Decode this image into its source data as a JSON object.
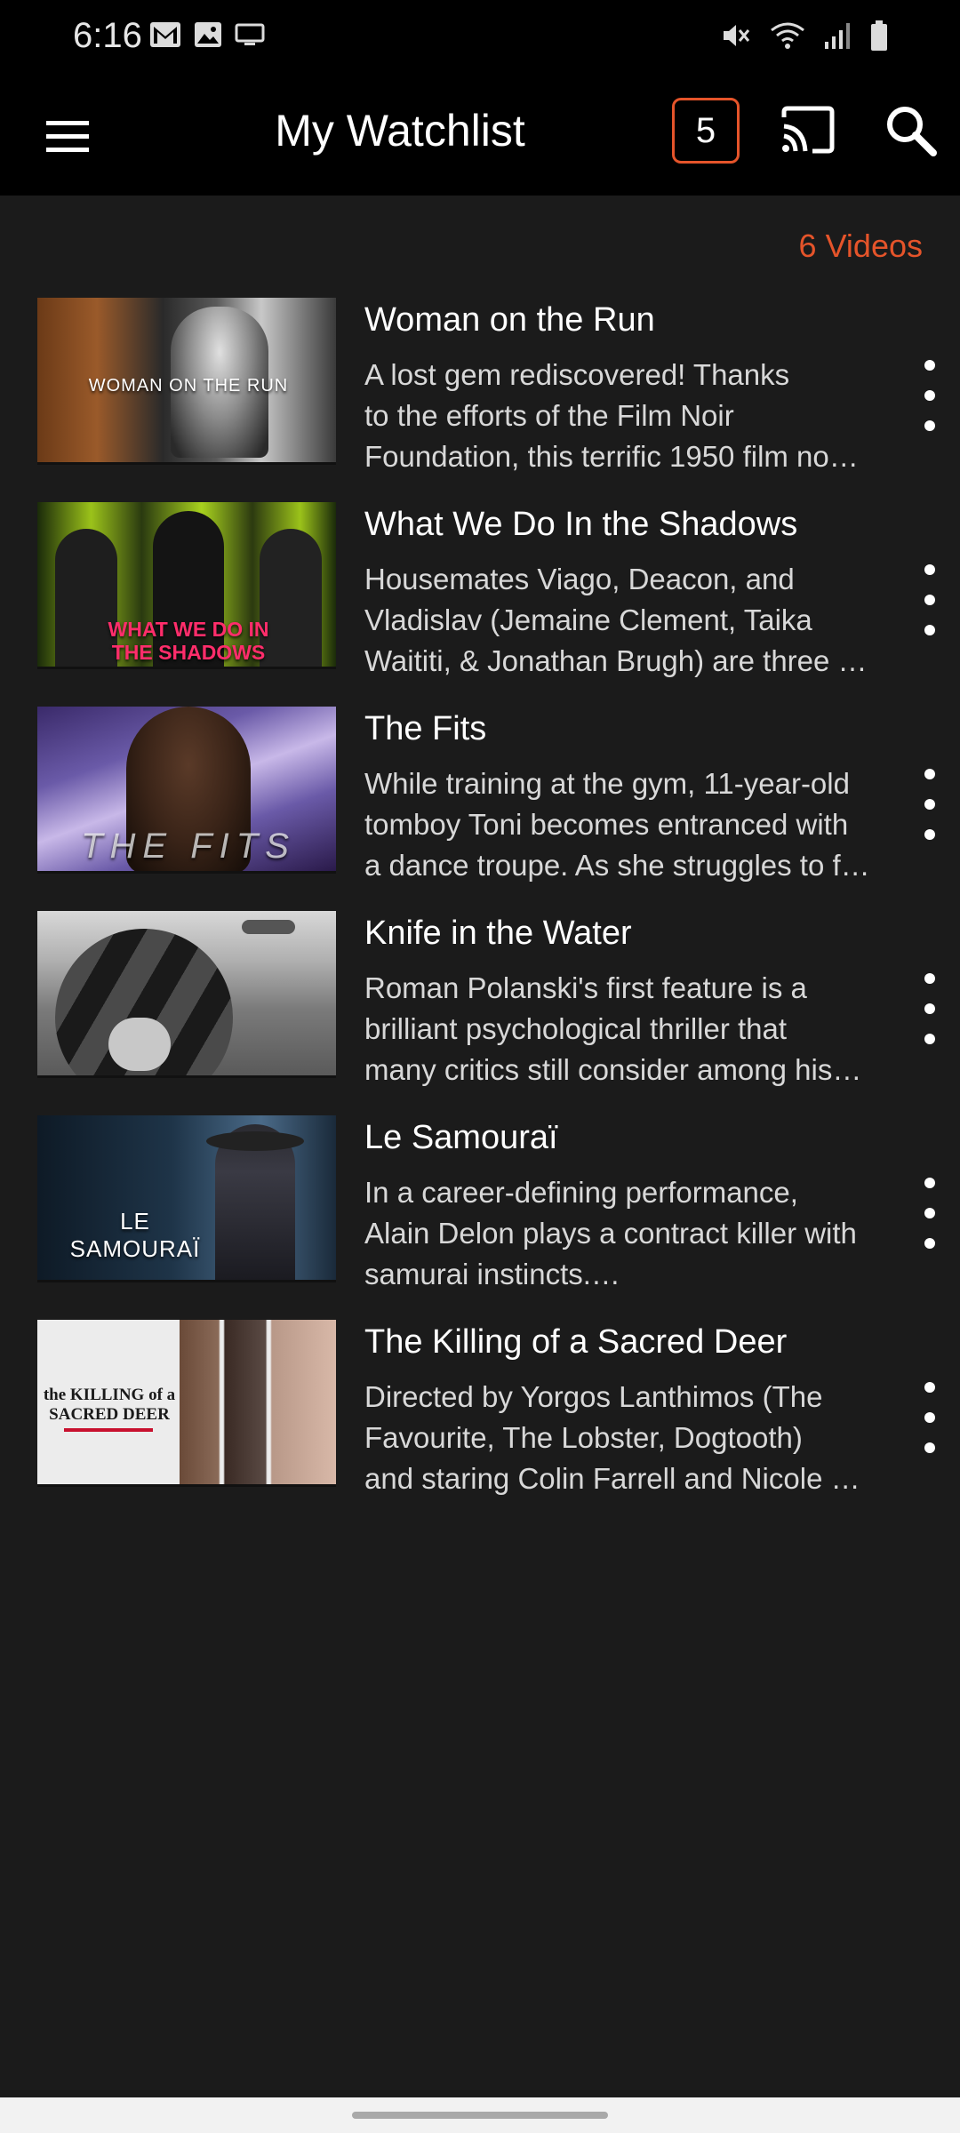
{
  "status_bar": {
    "time": "6:16",
    "left_icons": [
      "gmail-icon",
      "gallery-icon",
      "screen-mirror-icon"
    ],
    "right_icons": [
      "mute-icon",
      "wifi-icon",
      "signal-icon",
      "battery-icon"
    ]
  },
  "app_bar": {
    "title": "My Watchlist",
    "badge_count": "5",
    "accent_color": "#e5542a"
  },
  "list": {
    "count_label": "6 Videos",
    "items": [
      {
        "title": "Woman on the Run",
        "desc_lines": [
          "A lost gem rediscovered! Thanks",
          "to the efforts of the Film Noir",
          "Foundation, this terrific 1950 film no…"
        ],
        "thumb_text": "WOMAN ON THE RUN"
      },
      {
        "title": "What We Do In the Shadows",
        "desc_lines": [
          "Housemates Viago, Deacon, and",
          "Vladislav (Jemaine Clement, Taika",
          "Waititi, & Jonathan Brugh) are three …"
        ],
        "thumb_text": "WHAT WE DO IN THE SHADOWS"
      },
      {
        "title": "The Fits",
        "desc_lines": [
          "While training at the gym, 11-year-old",
          "tomboy Toni becomes entranced with",
          "a dance troupe. As she struggles to f…"
        ],
        "thumb_text": "THE FITS"
      },
      {
        "title": "Knife in the Water",
        "desc_lines": [
          "Roman Polanski's first feature is a",
          "brilliant psychological thriller that",
          "many critics still consider among his…"
        ],
        "thumb_text": ""
      },
      {
        "title": "Le Samouraï",
        "desc_lines": [
          "In a career-defining performance,",
          "Alain Delon plays a contract killer with",
          "samurai instincts.…"
        ],
        "thumb_text": "LE SAMOURAÏ"
      },
      {
        "title": "The Killing of a Sacred Deer",
        "desc_lines": [
          "Directed by Yorgos Lanthimos (The",
          "Favourite, The Lobster, Dogtooth)",
          "and staring Colin Farrell and Nicole …"
        ],
        "thumb_text": "the KILLING of a SACRED DEER"
      }
    ]
  }
}
